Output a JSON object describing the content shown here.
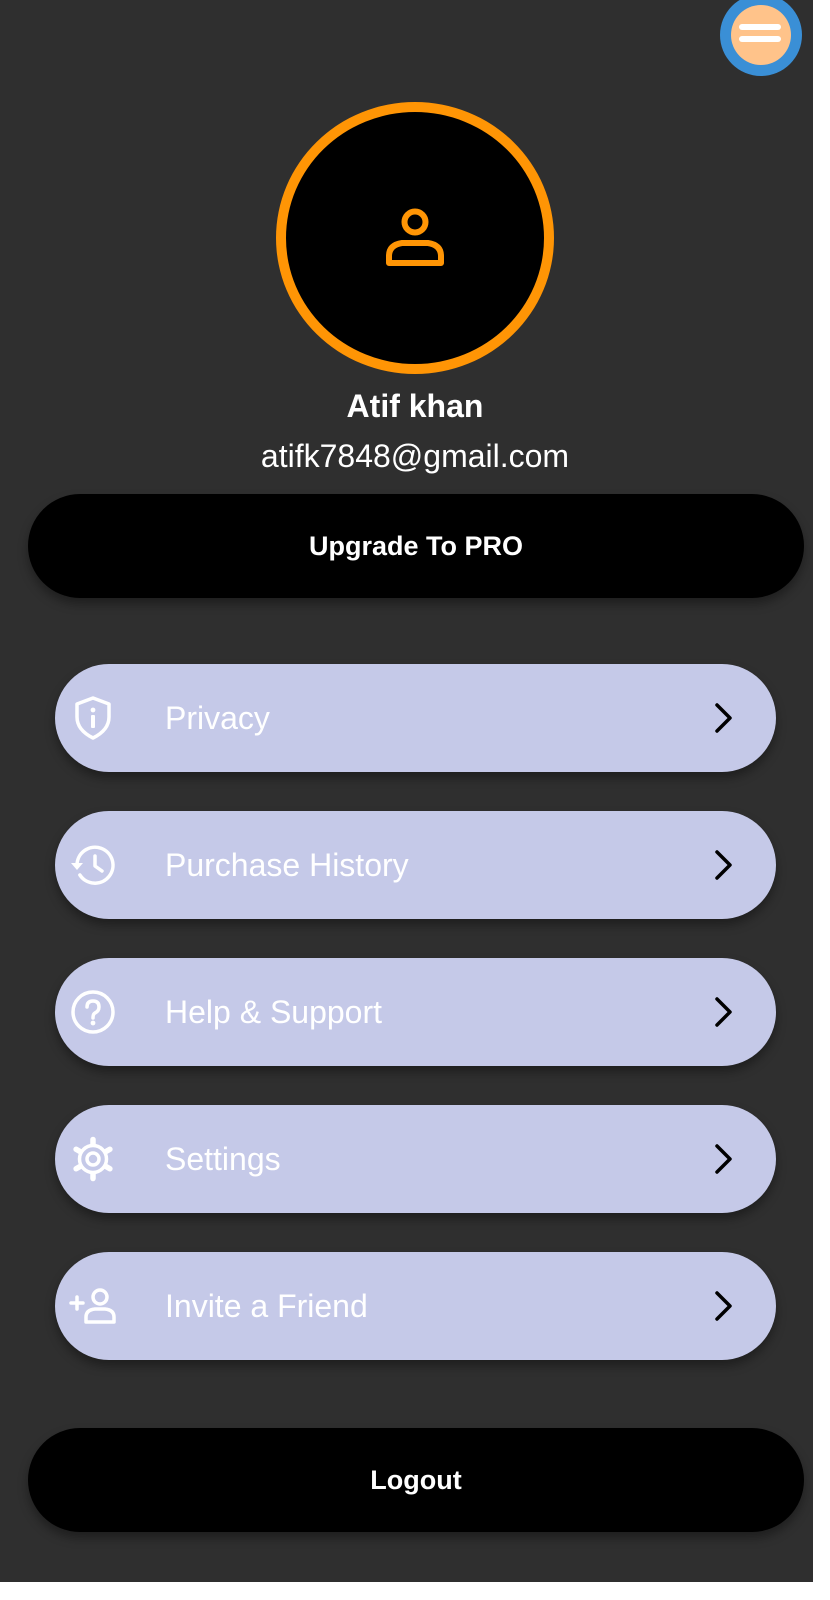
{
  "profile": {
    "name": "Atif khan",
    "email": "atifk7848@gmail.com"
  },
  "actions": {
    "upgrade_label": "Upgrade To PRO",
    "logout_label": "Logout"
  },
  "menu": {
    "items": [
      {
        "label": "Privacy",
        "icon": "shield-info-icon"
      },
      {
        "label": "Purchase History",
        "icon": "history-icon"
      },
      {
        "label": "Help & Support",
        "icon": "help-circle-icon"
      },
      {
        "label": "Settings",
        "icon": "gear-icon"
      },
      {
        "label": "Invite a Friend",
        "icon": "add-person-icon"
      }
    ]
  },
  "colors": {
    "background": "#2f2f2f",
    "accent": "#ff9505",
    "menu_item": "#c5c9e8",
    "button": "#000000",
    "fab": "#3a8fd6"
  }
}
